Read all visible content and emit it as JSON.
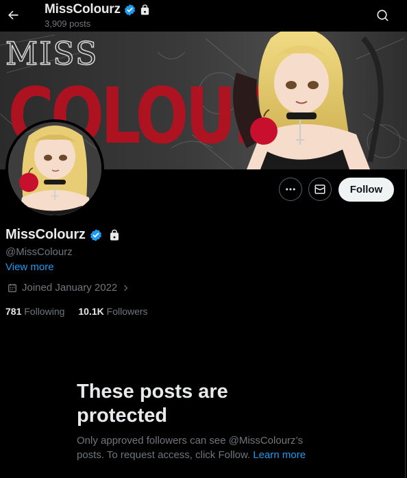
{
  "header": {
    "display_name": "MissColourz",
    "post_count": "3,909 posts"
  },
  "banner": {
    "text_small": "MISS",
    "text_large": "COLOURZ"
  },
  "actions": {
    "follow_label": "Follow"
  },
  "profile": {
    "display_name": "MissColourz",
    "handle": "@MissColourz",
    "view_more": "View more",
    "joined": "Joined January 2022"
  },
  "stats": {
    "following_count": "781",
    "following_label": "Following",
    "followers_count": "10.1K",
    "followers_label": "Followers"
  },
  "protected": {
    "title": "These posts are protected",
    "body": "Only approved followers can see @MissColourz’s posts. To request access, click Follow.",
    "learn_more": "Learn more"
  },
  "colors": {
    "accent": "#1d9bf0",
    "verified_blue": "#1d9bf0",
    "muted_text": "#71767b",
    "primary_text": "#e7e9ea",
    "banner_red": "#c8102e"
  },
  "icons": {
    "back": "arrow-left-icon",
    "verified": "verified-badge-icon",
    "lock": "lock-icon",
    "search": "search-icon",
    "more": "more-dots-icon",
    "message": "envelope-icon",
    "calendar": "calendar-icon",
    "chevron": "chevron-right-icon"
  }
}
